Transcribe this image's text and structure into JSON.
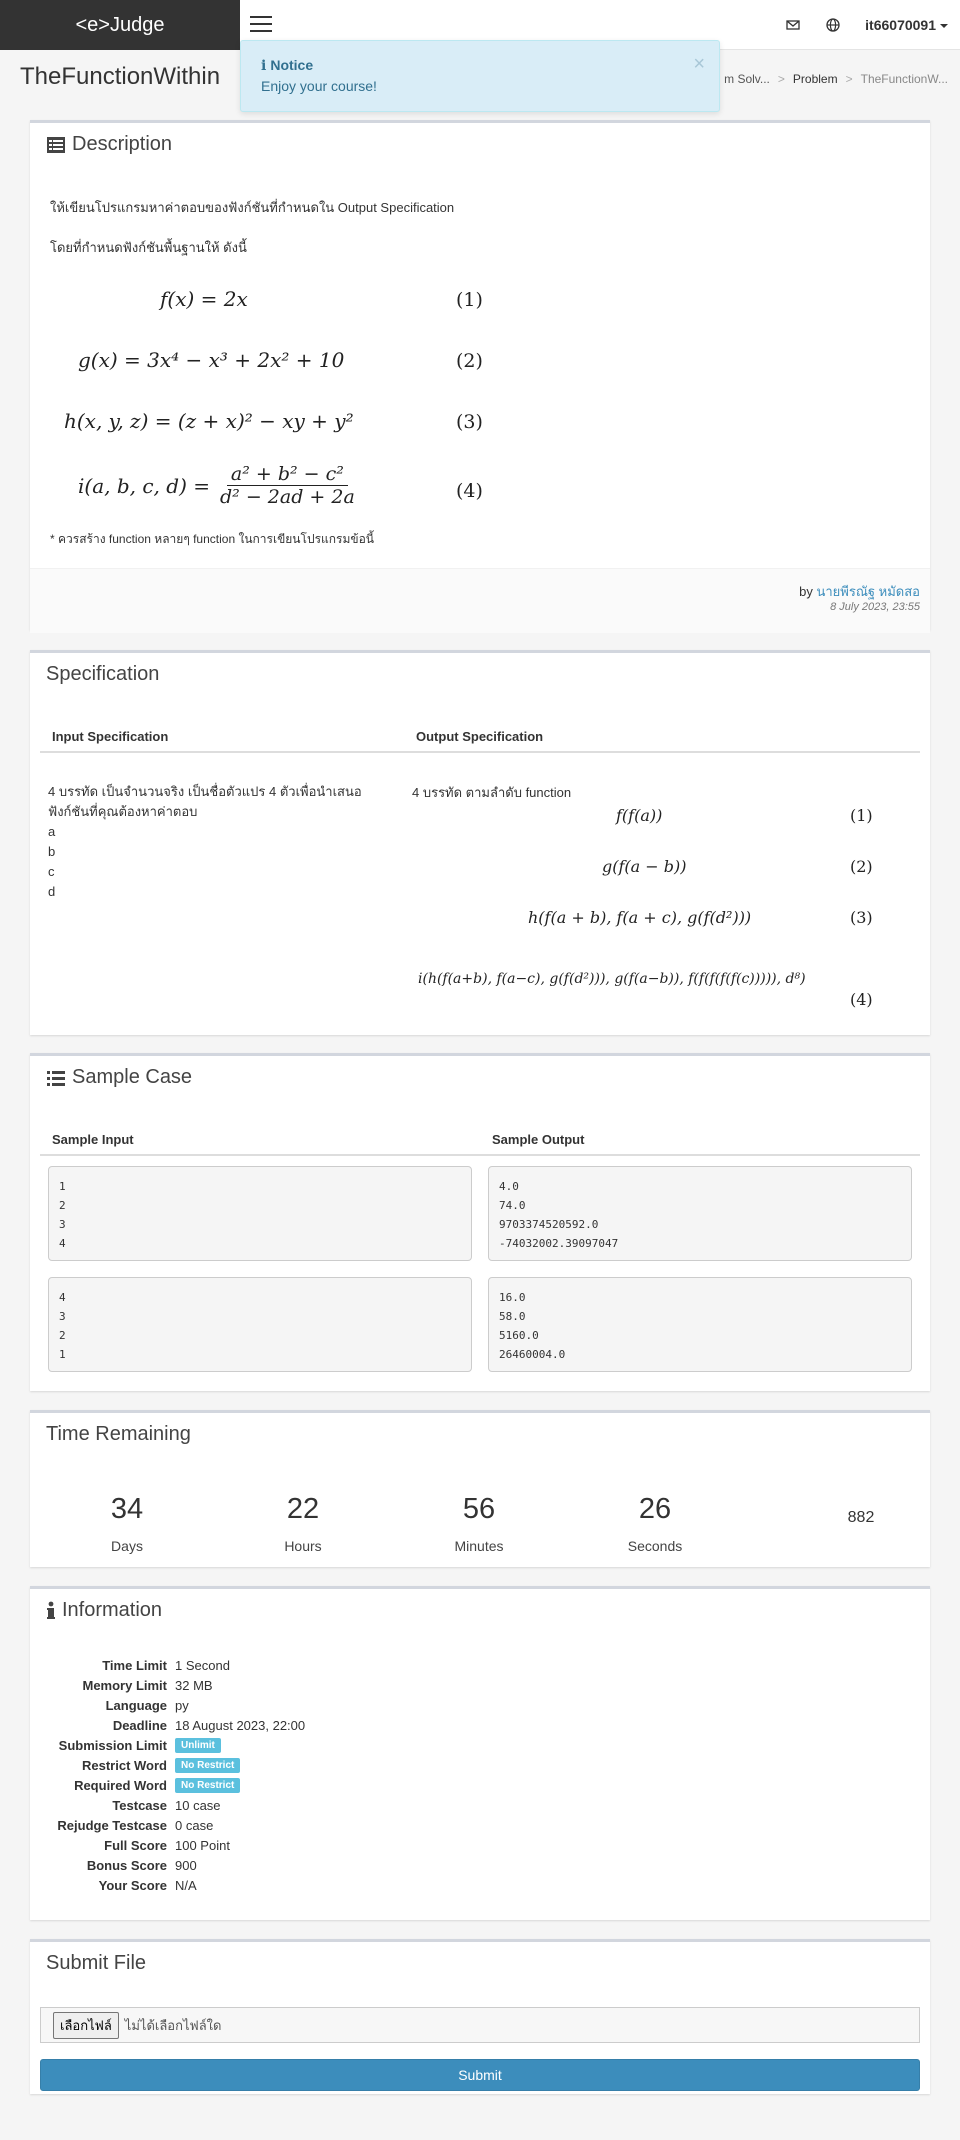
{
  "nav": {
    "brand": "<e>Judge",
    "user": "it66070091"
  },
  "notice": {
    "title": "Notice",
    "message": "Enjoy your course!",
    "close": "×"
  },
  "page": {
    "title": "TheFunctionWithin",
    "breadcrumb": [
      "m Solv...",
      "Problem",
      "TheFunctionW..."
    ]
  },
  "description": {
    "heading": "Description",
    "intro": "ให้เขียนโปรแกรมหาค่าตอบของฟังก์ชันที่กำหนดใน Output Specification",
    "intro2": "โดยที่กำหนดฟังก์ชันพื้นฐานให้ ดังนี้",
    "equations": {
      "f": "f(x) = 2x",
      "g": "g(x) = 3x⁴ − x³ + 2x² + 10",
      "h": "h(x, y, z) = (z + x)² − xy + y²",
      "i_lhs": "i(a, b, c, d) =",
      "i_num": "a² + b² − c²",
      "i_den": "d² − 2ad + 2a",
      "n1": "(1)",
      "n2": "(2)",
      "n3": "(3)",
      "n4": "(4)"
    },
    "note": "* ควรสร้าง function หลายๆ function ในการเขียนโปรแกรมข้อนี้",
    "by": "by",
    "author": "นายพีรณัฐ หมัดสอ",
    "date": "8 July 2023, 23:55"
  },
  "specification": {
    "heading": "Specification",
    "input_header": "Input Specification",
    "output_header": "Output Specification",
    "input_text": "4 บรรทัด เป็นจำนวนจริง เป็นชื่อตัวแปร 4 ตัวเพื่อนำเสนอฟังก์ชันที่คุณต้องหาค่าตอบ",
    "input_vars": [
      "a",
      "b",
      "c",
      "d"
    ],
    "output_text": "4 บรรทัด ตามลำดับ function",
    "out_eq1": "f(f(a))",
    "out_eq2": "g(f(a − b))",
    "out_eq3": "h(f(a + b), f(a + c), g(f(d²)))",
    "out_eq4": "i(h(f(a+b), f(a−c), g(f(d²))), g(f(a−b)), f(f(f(f(f(c))))), d⁸)",
    "n1": "(1)",
    "n2": "(2)",
    "n3": "(3)",
    "n4": "(4)"
  },
  "sample": {
    "heading": "Sample Case",
    "input_header": "Sample Input",
    "output_header": "Sample Output",
    "in1": "1\n2\n3\n4",
    "out1": "4.0\n74.0\n9703374520592.0\n-74032002.39097047",
    "in2": "4\n3\n2\n1",
    "out2": "16.0\n58.0\n5160.0\n26460004.0"
  },
  "time": {
    "heading": "Time Remaining",
    "days": "34",
    "days_label": "Days",
    "hours": "22",
    "hours_label": "Hours",
    "minutes": "56",
    "minutes_label": "Minutes",
    "seconds": "26",
    "seconds_label": "Seconds",
    "extra": "882"
  },
  "info": {
    "heading": "Information",
    "rows": [
      {
        "k": "Time Limit",
        "v": "1 Second"
      },
      {
        "k": "Memory Limit",
        "v": "32 MB"
      },
      {
        "k": "Language",
        "v": "py"
      },
      {
        "k": "Deadline",
        "v": "18 August 2023, 22:00"
      },
      {
        "k": "Submission Limit",
        "v": "Unlimit",
        "badge": true
      },
      {
        "k": "Restrict Word",
        "v": "No Restrict",
        "badge": true
      },
      {
        "k": "Required Word",
        "v": "No Restrict",
        "badge": true
      },
      {
        "k": "Testcase",
        "v": "10 case"
      },
      {
        "k": "Rejudge Testcase",
        "v": "0 case"
      },
      {
        "k": "Full Score",
        "v": "100 Point"
      },
      {
        "k": "Bonus Score",
        "v": "900"
      },
      {
        "k": "Your Score",
        "v": "N/A"
      }
    ]
  },
  "submit": {
    "heading": "Submit File",
    "choose": "เลือกไฟล์",
    "no_file": "ไม่ได้เลือกไฟล์ใด",
    "button": "Submit"
  },
  "colors": {
    "accent": "#3c8dbc",
    "badge": "#5bc0de",
    "notice": "#d9edf7"
  }
}
